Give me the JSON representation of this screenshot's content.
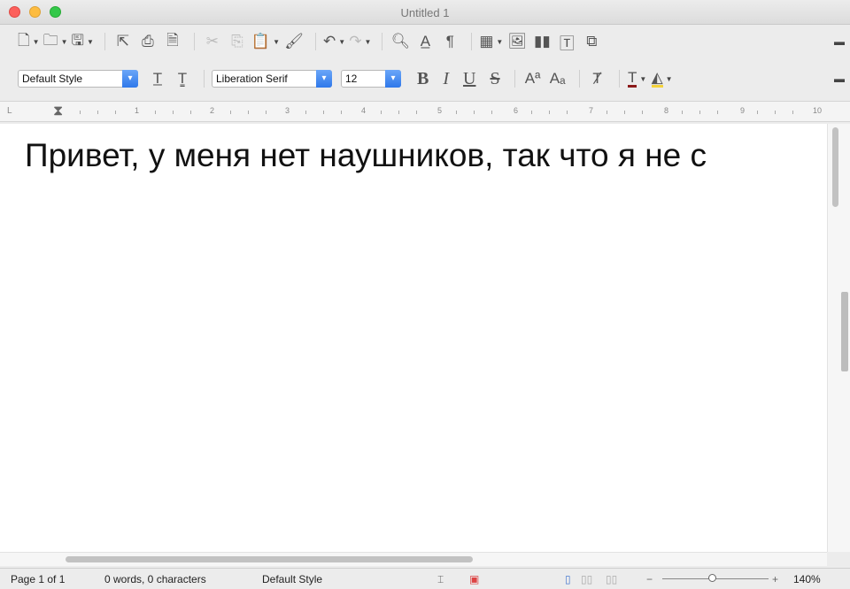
{
  "window": {
    "title": "Untitled 1"
  },
  "toolbar1": {
    "icons": [
      "new-icon",
      "open-icon",
      "save-icon",
      "export-icon",
      "print-icon",
      "print-preview-icon",
      "cut-icon",
      "copy-icon",
      "paste-icon",
      "clone-formatting-icon",
      "undo-icon",
      "redo-icon",
      "find-replace-icon",
      "spelling-icon",
      "formatting-marks-icon",
      "insert-table-icon",
      "insert-image-icon",
      "insert-chart-icon",
      "insert-textbox-icon",
      "insert-page-break-icon"
    ]
  },
  "toolbar2": {
    "paragraph_style": "Default Style",
    "font_name": "Liberation Serif",
    "font_size": "12",
    "bold_label": "B",
    "italic_label": "I",
    "underline_label": "U",
    "strike_label": "S"
  },
  "ruler": {
    "numbers": [
      "1",
      "2",
      "3",
      "4",
      "5",
      "6",
      "7",
      "8",
      "9",
      "10"
    ]
  },
  "document": {
    "text": "Привет, у меня нет наушников, так что я не с"
  },
  "status": {
    "page": "Page 1 of 1",
    "words": "0 words, 0 characters",
    "style": "Default Style",
    "zoom": "140%"
  }
}
